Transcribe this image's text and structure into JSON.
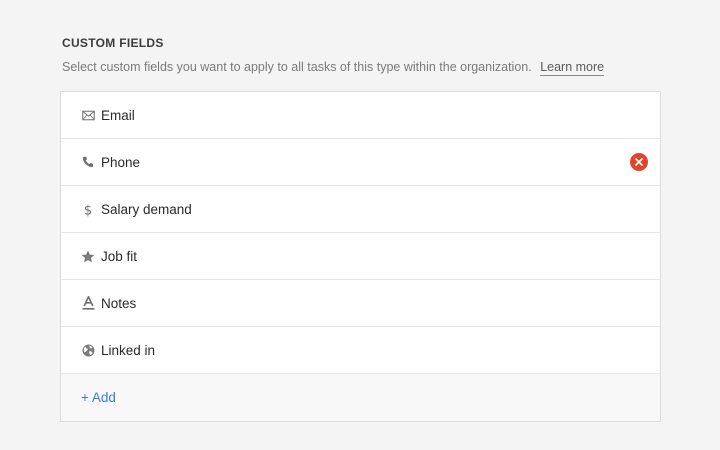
{
  "section": {
    "title": "CUSTOM FIELDS",
    "description": "Select custom fields you want to apply to all tasks of this type within the organization.",
    "learn_more": "Learn more"
  },
  "fields": [
    {
      "label": "Email",
      "icon": "envelope-icon"
    },
    {
      "label": "Phone",
      "icon": "phone-icon",
      "removable": true
    },
    {
      "label": "Salary demand",
      "icon": "dollar-icon"
    },
    {
      "label": "Job fit",
      "icon": "star-icon"
    },
    {
      "label": "Notes",
      "icon": "text-format-icon"
    },
    {
      "label": "Linked in",
      "icon": "globe-icon"
    }
  ],
  "add_label": "+ Add",
  "colors": {
    "remove": "#e1462a",
    "link": "#3a7bd5",
    "background": "#f4f4f5"
  }
}
